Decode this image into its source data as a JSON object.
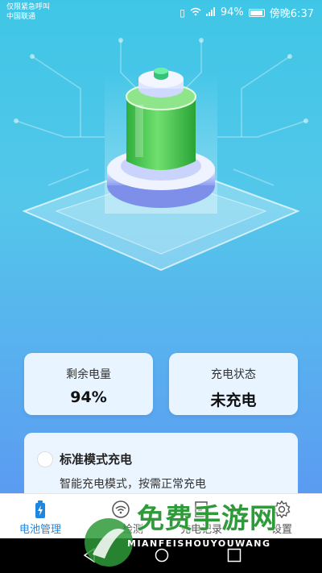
{
  "status_bar": {
    "line1": "仅限紧急呼叫",
    "line2": "中国联通",
    "battery_pct": "94%",
    "time": "傍晚6:37"
  },
  "stats": {
    "remaining": {
      "label": "剩余电量",
      "value": "94%"
    },
    "charging": {
      "label": "充电状态",
      "value": "未充电"
    }
  },
  "mode": {
    "title": "标准模式充电",
    "description": "智能充电模式，按需正常充电"
  },
  "tabs": [
    {
      "label": "电池管理",
      "icon": "battery-icon",
      "active": true
    },
    {
      "label": "检测",
      "icon": "wifi-icon",
      "active": false
    },
    {
      "label": "充电记录",
      "icon": "note-icon",
      "active": false
    },
    {
      "label": "设置",
      "icon": "gear-icon",
      "active": false
    }
  ],
  "watermark": {
    "title": "免费手游网",
    "subtitle": "MIANFEISHOUYOUWANG"
  },
  "colors": {
    "accent": "#1f86e0",
    "battery_green": "#3ec24a",
    "watermark_green": "#2f9a3a"
  }
}
